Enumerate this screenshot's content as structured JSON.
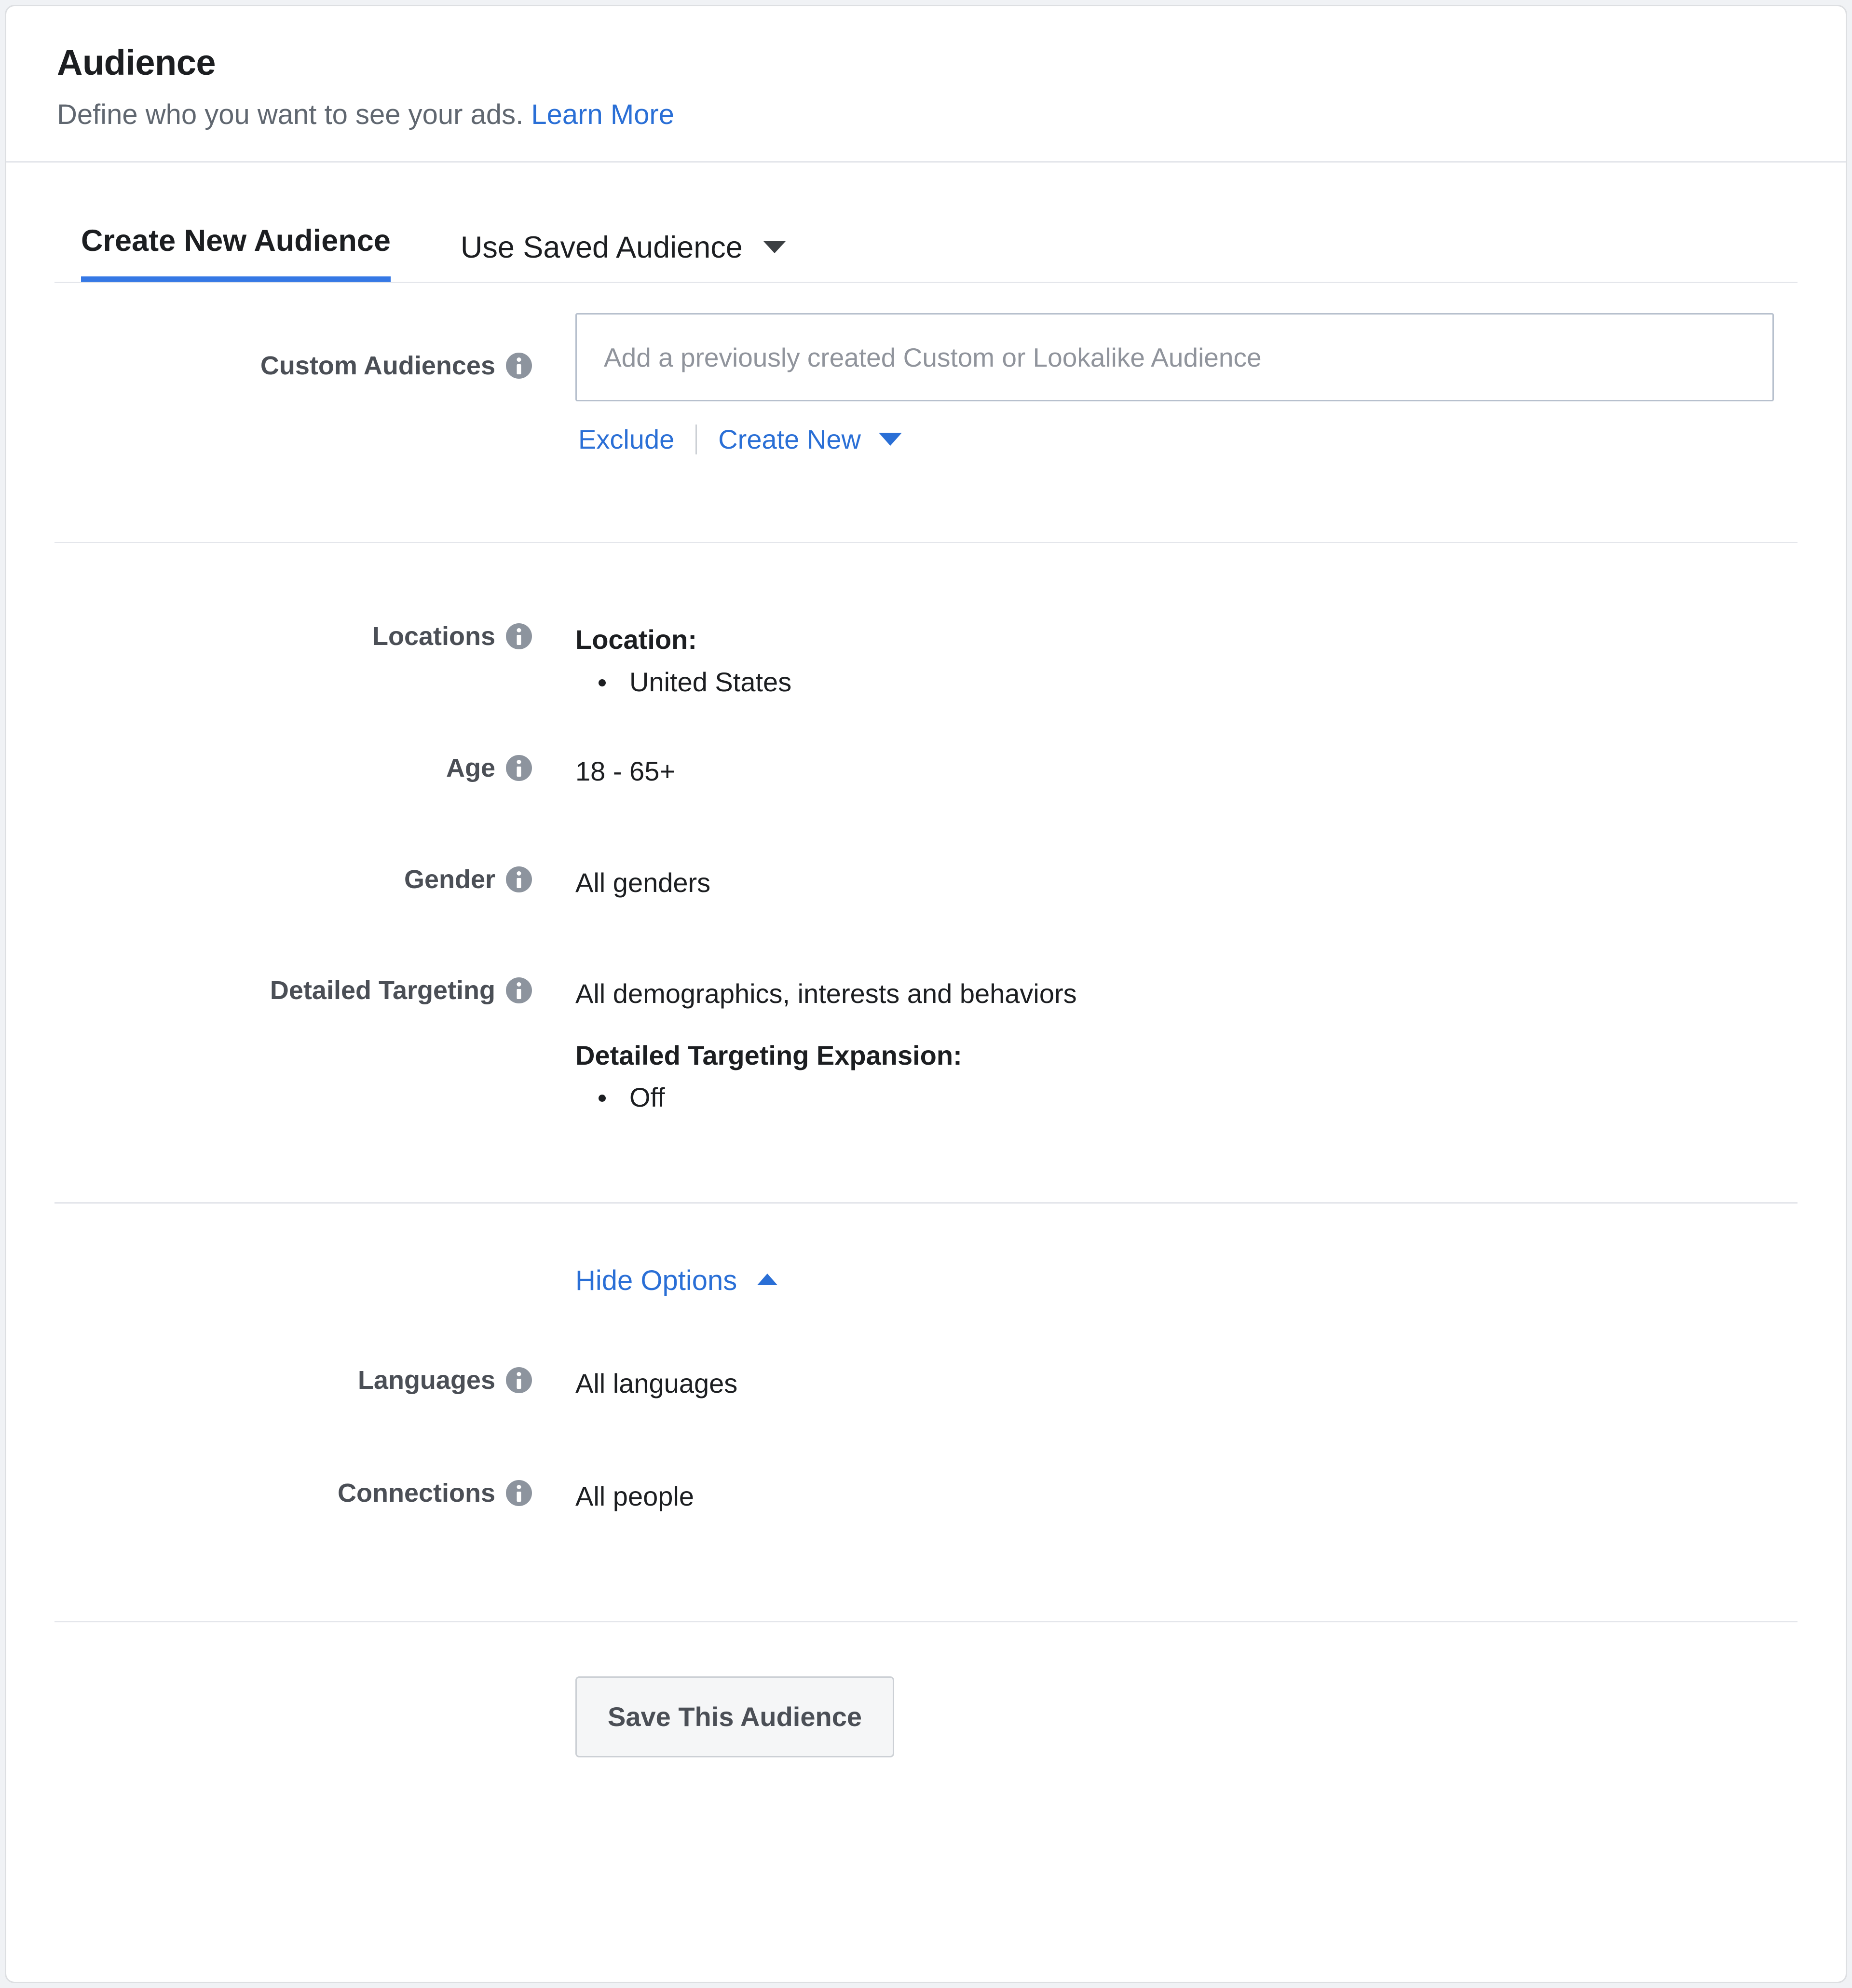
{
  "header": {
    "title": "Audience",
    "subtitle": "Define who you want to see your ads.",
    "learn_more": "Learn More"
  },
  "tabs": [
    {
      "label": "Create New Audience",
      "active": true
    },
    {
      "label": "Use Saved Audience",
      "active": false,
      "has_caret": true
    }
  ],
  "custom_audiences": {
    "label": "Custom Audiences",
    "input_placeholder": "Add a previously created Custom or Lookalike Audience",
    "input_value": "",
    "exclude_label": "Exclude",
    "create_new_label": "Create New"
  },
  "locations": {
    "label": "Locations",
    "value_heading": "Location:",
    "items": [
      "United States"
    ]
  },
  "age": {
    "label": "Age",
    "value": "18 - 65+"
  },
  "gender": {
    "label": "Gender",
    "value": "All genders"
  },
  "detailed_targeting": {
    "label": "Detailed Targeting",
    "value": "All demographics, interests and behaviors",
    "expansion_heading": "Detailed Targeting Expansion:",
    "expansion_items": [
      "Off"
    ]
  },
  "options_toggle": {
    "label": "Hide Options"
  },
  "languages": {
    "label": "Languages",
    "value": "All languages"
  },
  "connections": {
    "label": "Connections",
    "value": "All people"
  },
  "footer": {
    "save_label": "Save This Audience"
  },
  "colors": {
    "accent_blue": "#3578e5",
    "link_blue": "#2a6fd6",
    "label_gray": "#4b4f56",
    "info_icon_gray": "#8d949e",
    "divider_gray": "#e4e6eb",
    "button_bg": "#f5f6f7"
  }
}
